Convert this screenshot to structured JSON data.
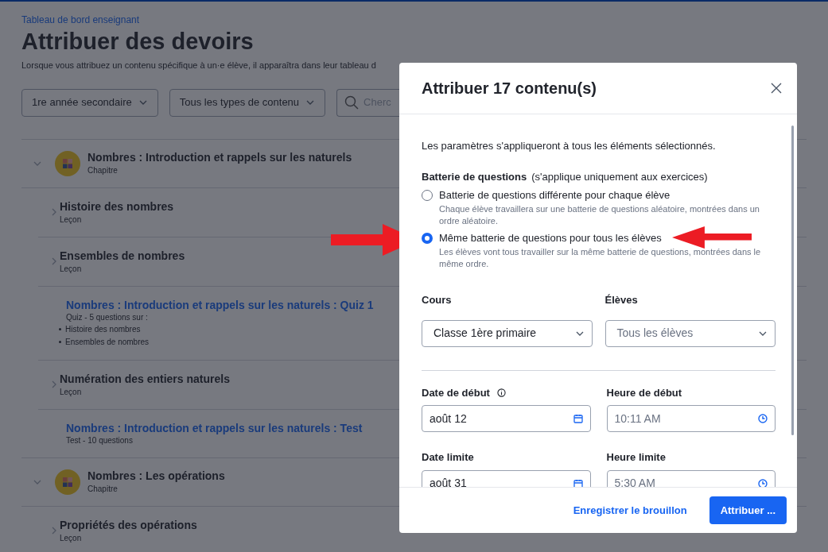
{
  "breadcrumb": "Tableau de bord enseignant",
  "title": "Attribuer des devoirs",
  "subtitle": "Lorsque vous attribuez un contenu spécifique à un·e élève, il apparaîtra dans leur tableau d",
  "filters": [
    {
      "kind": "select",
      "value": "1re année secondaire"
    },
    {
      "kind": "select",
      "value": "Tous les types de contenu"
    },
    {
      "kind": "search",
      "placeholder": "Cherc"
    }
  ],
  "items": [
    {
      "kind": "chapter",
      "title": "Nombres : Introduction et rappels sur les naturels",
      "subtitle": "Chapitre",
      "expanded": true
    },
    {
      "kind": "lesson",
      "title": "Histoire des nombres",
      "subtitle": "Leçon",
      "expanded": false
    },
    {
      "kind": "lesson",
      "title": "Ensembles de nombres",
      "subtitle": "Leçon",
      "expanded": false
    },
    {
      "kind": "assessment",
      "title": "Nombres : Introduction et rappels sur les naturels : Quiz 1",
      "subtitle": "Quiz  - 5 questions sur :",
      "bullets": [
        "Histoire des nombres",
        "Ensembles de nombres"
      ]
    },
    {
      "kind": "lesson",
      "title": "Numération des entiers naturels",
      "subtitle": "Leçon",
      "expanded": false
    },
    {
      "kind": "assessment",
      "title": "Nombres : Introduction et rappels sur les naturels : Test",
      "subtitle": "Test - 10 questions"
    },
    {
      "kind": "chapter",
      "title": "Nombres : Les opérations",
      "subtitle": "Chapitre",
      "expanded": true
    },
    {
      "kind": "lesson",
      "title": "Propriétés des opérations",
      "subtitle": "Leçon",
      "expanded": false
    }
  ],
  "modal": {
    "title": "Attribuer 17 contenu(s)",
    "intro": "Les paramètres s'appliqueront à tous les éléments sélectionnés.",
    "question_set": {
      "label": "Batterie de questions",
      "note": "(s'applique uniquement aux exercices)",
      "options": [
        {
          "label": "Batterie de questions différente pour chaque élève",
          "description": "Chaque élève travaillera sur une batterie de questions aléatoire, montrées dans un ordre aléatoire.",
          "selected": false
        },
        {
          "label": "Même batterie de questions pour tous les élèves",
          "description": "Les élèves vont tous travailler sur la même batterie de questions, montrées dans le même ordre.",
          "selected": true
        }
      ]
    },
    "course": {
      "label": "Cours",
      "value": "Classe 1ère primaire"
    },
    "students": {
      "label": "Élèves",
      "placeholder": "Tous les élèves"
    },
    "start_date": {
      "label": "Date de début",
      "value": "août 12"
    },
    "start_time": {
      "label": "Heure de début",
      "value": "10:11 AM"
    },
    "due_date": {
      "label": "Date limite",
      "value": "août 31"
    },
    "due_time": {
      "label": "Heure limite",
      "value": "5:30 AM"
    },
    "save_draft": "Enregistrer le brouillon",
    "assign": "Attribuer ..."
  }
}
